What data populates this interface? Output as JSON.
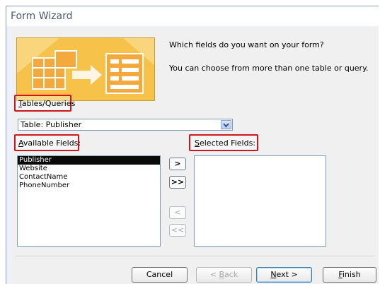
{
  "window": {
    "title": "Form Wizard"
  },
  "intro": {
    "question": "Which fields do you want on your form?",
    "hint": "You can choose from more than one table or query."
  },
  "tables": {
    "label_key": "T",
    "label_rest": "ables/Queries",
    "selected": "Table: Publisher",
    "dropdown_icon": "chevron-down-icon"
  },
  "available": {
    "label_key": "A",
    "label_rest": "vailable Fields:",
    "items": [
      "Publisher",
      "Website",
      "ContactName",
      "PhoneNumber"
    ],
    "selected_index": 0
  },
  "selected_fields": {
    "label_key": "S",
    "label_rest": "elected Fields:",
    "items": []
  },
  "move_buttons": {
    "add_one": ">",
    "add_all": ">>",
    "remove_one": "<",
    "remove_all": "<<"
  },
  "buttons": {
    "cancel": "Cancel",
    "back_prefix": "< ",
    "back_key": "B",
    "back_rest": "ack",
    "next_key": "N",
    "next_rest": "ext >",
    "finish_key": "F",
    "finish_rest": "inish"
  },
  "colors": {
    "highlight_border": "#d0161d",
    "wizard_image": "#f6c24a",
    "selection": "#0a0a0a"
  }
}
